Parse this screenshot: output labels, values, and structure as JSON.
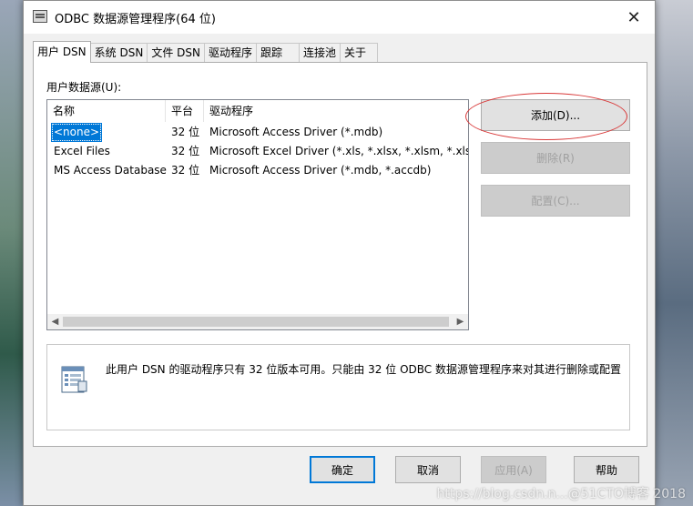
{
  "window": {
    "title": "ODBC 数据源管理程序(64 位)",
    "close_glyph": "✕"
  },
  "tabs": [
    {
      "label": "用户 DSN"
    },
    {
      "label": "系统 DSN"
    },
    {
      "label": "文件 DSN"
    },
    {
      "label": "驱动程序"
    },
    {
      "label": "跟踪"
    },
    {
      "label": "连接池"
    },
    {
      "label": "关于"
    }
  ],
  "main": {
    "group_label": "用户数据源(U):",
    "columns": [
      "名称",
      "平台",
      "驱动程序"
    ],
    "rows": [
      {
        "name": "<none>",
        "platform": "32 位",
        "driver": "Microsoft Access Driver (*.mdb)"
      },
      {
        "name": "Excel Files",
        "platform": "32 位",
        "driver": "Microsoft Excel Driver (*.xls, *.xlsx, *.xlsm, *.xlsb)"
      },
      {
        "name": "MS Access Database",
        "platform": "32 位",
        "driver": "Microsoft Access Driver (*.mdb, *.accdb)"
      }
    ],
    "buttons": {
      "add": "添加(D)...",
      "remove": "删除(R)",
      "configure": "配置(C)..."
    },
    "info_text": "此用户 DSN 的驱动程序只有 32 位版本可用。只能由 32 位 ODBC 数据源管理程序来对其进行删除或配置"
  },
  "footer": {
    "ok": "确定",
    "cancel": "取消",
    "apply": "应用(A)",
    "help": "帮助"
  },
  "watermark": "https://blog.csdn.n...@51CTO博客 2018",
  "colors": {
    "selection": "#0078d7",
    "annotation_circle": "#d93a3a"
  }
}
